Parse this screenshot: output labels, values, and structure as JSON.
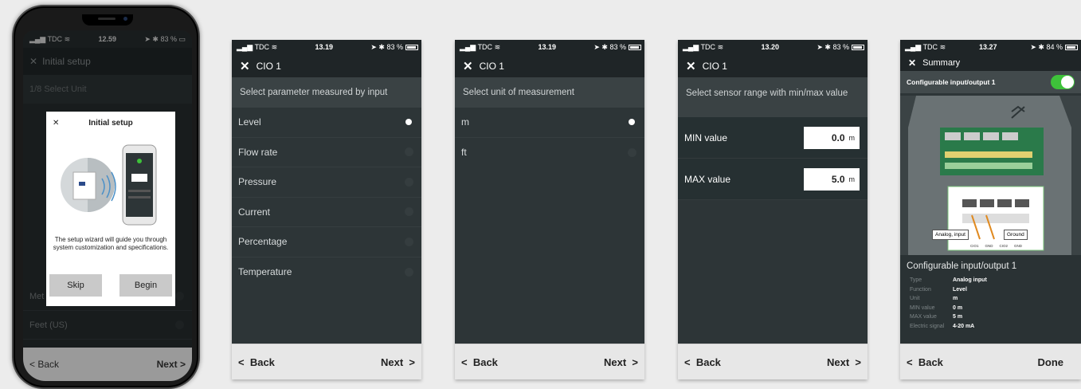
{
  "phone": {
    "status": {
      "carrier": "TDC",
      "time": "12.59",
      "battery": "83 %"
    },
    "header_title": "Initial setup",
    "step": "1/8 Select Unit",
    "list": [
      {
        "label": "Met"
      },
      {
        "label": "Feet (US)"
      }
    ],
    "footer": {
      "back": "Back",
      "next": "Next"
    },
    "dialog": {
      "title": "Initial setup",
      "text": "The setup wizard will guide you through system customization and specifications.",
      "skip": "Skip",
      "begin": "Begin"
    }
  },
  "screen2": {
    "status": {
      "carrier": "TDC",
      "time": "13.19",
      "battery": "83 %"
    },
    "title": "CIO 1",
    "instruction": "Select parameter measured by input",
    "options": [
      {
        "label": "Level",
        "selected": true
      },
      {
        "label": "Flow rate",
        "selected": false
      },
      {
        "label": "Pressure",
        "selected": false
      },
      {
        "label": "Current",
        "selected": false
      },
      {
        "label": "Percentage",
        "selected": false
      },
      {
        "label": "Temperature",
        "selected": false
      }
    ],
    "footer": {
      "back": "Back",
      "next": "Next"
    }
  },
  "screen3": {
    "status": {
      "carrier": "TDC",
      "time": "13.19",
      "battery": "83 %"
    },
    "title": "CIO 1",
    "instruction": "Select unit of measurement",
    "options": [
      {
        "label": "m",
        "selected": true
      },
      {
        "label": "ft",
        "selected": false
      }
    ],
    "footer": {
      "back": "Back",
      "next": "Next"
    }
  },
  "screen4": {
    "status": {
      "carrier": "TDC",
      "time": "13.20",
      "battery": "83 %"
    },
    "title": "CIO 1",
    "instruction": "Select sensor range with min/max value",
    "min": {
      "label": "MIN value",
      "value": "0.0",
      "unit": "m"
    },
    "max": {
      "label": "MAX value",
      "value": "5.0",
      "unit": "m"
    },
    "footer": {
      "back": "Back",
      "next": "Next"
    }
  },
  "screen5": {
    "status": {
      "carrier": "TDC",
      "time": "13.27",
      "battery": "84 %"
    },
    "title": "Summary",
    "section": "Configurable input/output 1",
    "callouts": {
      "analog": "Analog, input",
      "ground": "Ground"
    },
    "pins": [
      "CIO1",
      "GND",
      "CIO2",
      "GND"
    ],
    "info_title": "Configurable input/output 1",
    "details": [
      {
        "key": "Type",
        "value": "Analog input"
      },
      {
        "key": "Function",
        "value": "Level"
      },
      {
        "key": "Unit",
        "value": "m"
      },
      {
        "key": "MIN value",
        "value": "0 m"
      },
      {
        "key": "MAX value",
        "value": "5 m"
      },
      {
        "key": "Electric signal",
        "value": "4-20 mA"
      }
    ],
    "footer": {
      "back": "Back",
      "done": "Done"
    }
  },
  "colors": {
    "toggle_on": "#3ec23a",
    "app_bg": "#2d3537",
    "footer_bg": "#e7e7e7"
  }
}
